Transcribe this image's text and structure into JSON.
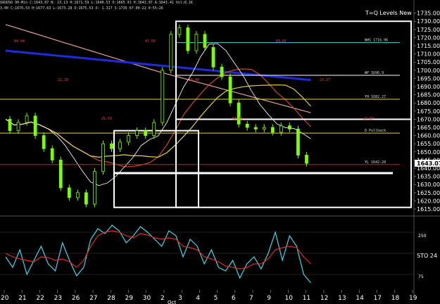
{
  "header": {
    "line1": "XAUUSD 90-Min  C:1643.07  N:  23.13  H:1671.59  L:1640.53  O:1665.91  H:1643.07  A:1643.41  Vol:8.1K",
    "line2": "3.00  C:1676.53  H:1677.63  L:1673.28  O:1675.53  X: 1.317  S:1735  07-09-22  0:55:26"
  },
  "indicator_title": "T=Q Levels New",
  "colors": {
    "background": "#000000",
    "candle": "#7CFC00",
    "blue_ma": "#1e2bd6",
    "pink_ma": "#e8a0a0",
    "red_ma": "#cc4a2a",
    "yellow_ma": "#e2d24b",
    "white_ma": "#f2f2f2",
    "cyan_level": "#3fbfd0",
    "stoch_k": "#3fd8e8",
    "stoch_d": "#e22a2a",
    "box": "#ffffff"
  },
  "chart_data": [
    {
      "type": "line",
      "title": "XAUUSD 90-Min",
      "ylim": [
        1612,
        1737
      ],
      "y_ticks": [
        "1735.00",
        "1730.00",
        "1725.00",
        "1720.00",
        "1715.00",
        "1710.00",
        "1705.00",
        "1700.00",
        "1695.00",
        "1690.00",
        "1685.00",
        "1680.00",
        "1675.00",
        "1670.00",
        "1665.00",
        "1660.00",
        "1655.00",
        "1650.00",
        "1645.00",
        "1640.00",
        "1635.00",
        "1630.00",
        "1625.00",
        "1620.00",
        "1615.00"
      ],
      "current_price": "1643.07",
      "x": [
        0,
        0.5,
        1,
        1.5,
        2,
        2.5,
        3,
        3.5,
        4,
        4.5,
        5,
        5.5,
        6,
        6.5,
        7,
        7.5,
        8,
        8.5,
        9,
        9.5,
        10,
        10.5,
        11,
        11.5,
        12,
        12.5,
        13,
        13.5,
        14,
        14.4
      ],
      "series": [
        {
          "name": "Price",
          "values": [
            1670,
            1663,
            1668,
            1672,
            1660,
            1652,
            1645,
            1628,
            1622,
            1625,
            1618,
            1638,
            1655,
            1652,
            1656,
            1660,
            1663,
            1660,
            1668,
            1700,
            1722,
            1726,
            1712,
            1722,
            1714,
            1702,
            1696,
            1680,
            1667,
            1665,
            1664,
            1665,
            1662,
            1666,
            1664,
            1648,
            1643
          ]
        }
      ],
      "level_lines": [
        {
          "label": "WHS 1716.96",
          "value": 1716.96
        },
        {
          "label": "WP 1696.9",
          "value": 1696.9
        },
        {
          "label": "YH 1682.27",
          "value": 1682.27
        },
        {
          "label": "D Pullback",
          "value": 1661.5
        },
        {
          "label": "YL 1642.28",
          "value": 1642.28
        }
      ],
      "annotations": [
        "84.94",
        "21.39",
        "25.59",
        "47.56",
        "58.48",
        "58.56",
        "03.87",
        "23.17",
        "24.87"
      ],
      "x_labels": [
        "20",
        "21",
        "22",
        "23",
        "26",
        "27",
        "28",
        "29",
        "30",
        "2",
        "3",
        "4",
        "5",
        "6",
        "7",
        "9",
        "10",
        "11",
        "12",
        "13",
        "14",
        "17",
        "18",
        "19"
      ],
      "x_sublabel": "Oct"
    },
    {
      "type": "line",
      "title": "STO 24",
      "ylim": [
        0,
        100
      ],
      "y_ticks": [
        "250",
        "75"
      ],
      "series": [
        {
          "name": "K",
          "values": [
            45,
            30,
            55,
            20,
            40,
            60,
            35,
            25,
            65,
            40,
            18,
            30,
            70,
            85,
            78,
            90,
            82,
            65,
            75,
            88,
            80,
            70,
            60,
            82,
            75,
            45,
            70,
            60,
            35,
            55,
            30,
            25,
            40,
            15,
            35,
            45,
            28,
            50,
            80,
            40,
            75,
            60,
            20,
            8
          ]
        },
        {
          "name": "D",
          "values": [
            50,
            45,
            42,
            40,
            38,
            45,
            44,
            40,
            42,
            38,
            30,
            40,
            60,
            75,
            80,
            82,
            80,
            75,
            72,
            78,
            76,
            72,
            70,
            72,
            70,
            60,
            58,
            55,
            45,
            42,
            38,
            32,
            30,
            28,
            30,
            35,
            35,
            42,
            55,
            58,
            60,
            58,
            45,
            35
          ]
        }
      ]
    }
  ]
}
